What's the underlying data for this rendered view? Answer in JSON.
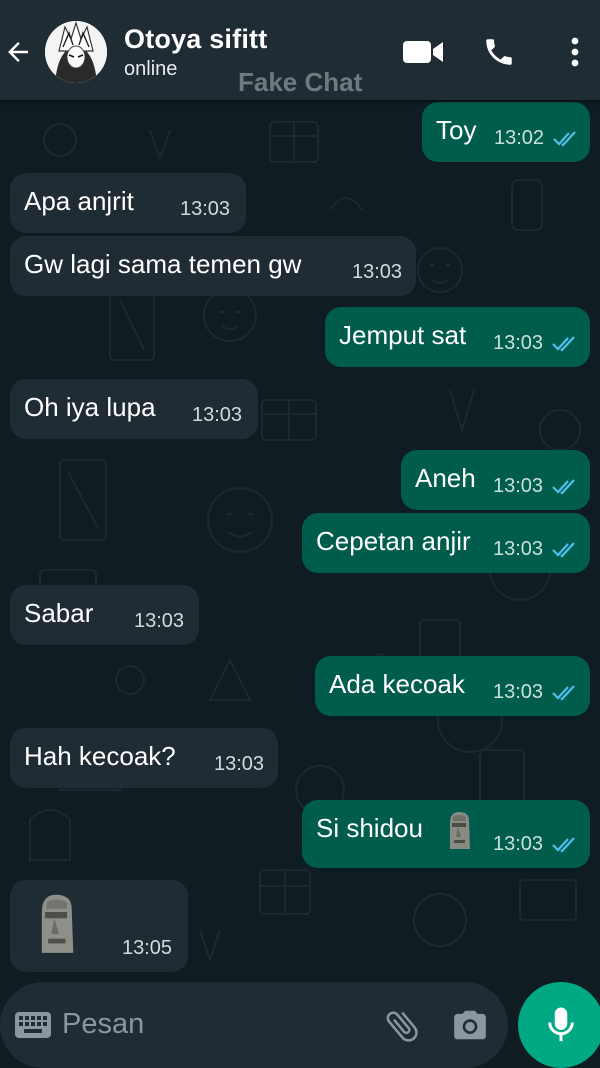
{
  "header": {
    "contact_name": "Otoya sifitt",
    "status": "online",
    "watermark": "Fake Chat"
  },
  "messages": [
    {
      "dir": "out",
      "text": "Toy",
      "time": "13:02",
      "read": true
    },
    {
      "dir": "in",
      "text": "Apa anjrit",
      "time": "13:03"
    },
    {
      "dir": "in",
      "text": "Gw lagi sama temen gw",
      "time": "13:03"
    },
    {
      "dir": "out",
      "text": "Jemput sat",
      "time": "13:03",
      "read": true
    },
    {
      "dir": "in",
      "text": "Oh iya lupa",
      "time": "13:03"
    },
    {
      "dir": "out",
      "text": "Aneh",
      "time": "13:03",
      "read": true
    },
    {
      "dir": "out",
      "text": "Cepetan anjir",
      "time": "13:03",
      "read": true
    },
    {
      "dir": "in",
      "text": "Sabar",
      "time": "13:03"
    },
    {
      "dir": "out",
      "text": "Ada kecoak",
      "time": "13:03",
      "read": true
    },
    {
      "dir": "in",
      "text": "Hah kecoak?",
      "time": "13:03"
    },
    {
      "dir": "out",
      "text": "Si shidou",
      "emoji": "moai",
      "time": "13:03",
      "read": true
    },
    {
      "dir": "in",
      "text": "",
      "emoji": "moai",
      "time": "13:05"
    }
  ],
  "input": {
    "placeholder": "Pesan"
  },
  "icons": {
    "back": "arrow-left-icon",
    "video": "video-call-icon",
    "call": "phone-icon",
    "menu": "more-vert-icon",
    "keyboard": "keyboard-icon",
    "attach": "paperclip-icon",
    "camera": "camera-icon",
    "mic": "microphone-icon",
    "read": "double-check-icon"
  },
  "colors": {
    "header_bg": "#1f2c33",
    "chat_bg": "#0f1c22",
    "incoming_bubble": "#1f2c33",
    "outgoing_bubble": "#005c4b",
    "read_ticks": "#53bdeb",
    "accent": "#00a884"
  }
}
